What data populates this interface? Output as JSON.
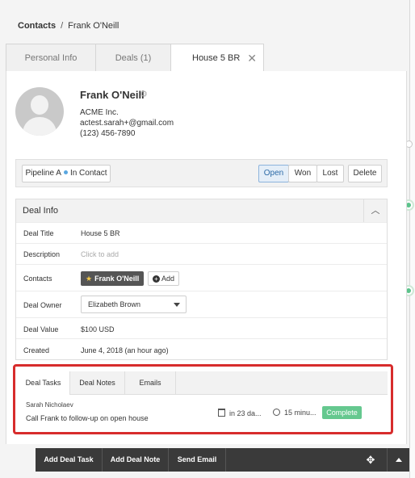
{
  "breadcrumb": {
    "root": "Contacts",
    "separator": "/",
    "current": "Frank O'Neill"
  },
  "tabs": [
    {
      "label": "Personal Info"
    },
    {
      "label": "Deals (1)"
    },
    {
      "label": "House 5 BR",
      "active": true,
      "close_icon": "close-icon"
    }
  ],
  "contact": {
    "name": "Frank O'Neill",
    "company": "ACME Inc.",
    "email": "actest.sarah+@gmail.com",
    "phone": "(123) 456-7890"
  },
  "pipeline": {
    "name": "Pipeline A",
    "stage": "In Contact",
    "status_buttons": [
      "Open",
      "Won",
      "Lost"
    ],
    "selected_status": "Open",
    "delete_label": "Delete"
  },
  "deal_info": {
    "title": "Deal Info",
    "rows": {
      "deal_title": {
        "label": "Deal Title",
        "value": "House 5 BR"
      },
      "description": {
        "label": "Description",
        "placeholder": "Click to add"
      },
      "contacts": {
        "label": "Contacts",
        "chip": "Frank O'Neill",
        "add_label": "Add"
      },
      "deal_owner": {
        "label": "Deal Owner",
        "value": "Elizabeth Brown"
      },
      "deal_value": {
        "label": "Deal Value",
        "value": "$100 USD"
      },
      "created": {
        "label": "Created",
        "value": "June 4, 2018 (an hour ago)"
      }
    }
  },
  "subtabs": [
    "Deal Tasks",
    "Deal Notes",
    "Emails"
  ],
  "task": {
    "assignee": "Sarah Nicholaev",
    "title": "Call Frank to follow-up on open house",
    "due": "in 23 da...",
    "duration": "15 minu...",
    "complete_label": "Complete"
  },
  "bottom_bar": {
    "add_task": "Add Deal Task",
    "add_note": "Add Deal Note",
    "send_email": "Send Email"
  },
  "colors": {
    "accent_blue": "#2c6aa6",
    "complete_green": "#65c88f",
    "highlight_red": "#d72c2c",
    "toolbar_dark": "#3a3a3a"
  }
}
